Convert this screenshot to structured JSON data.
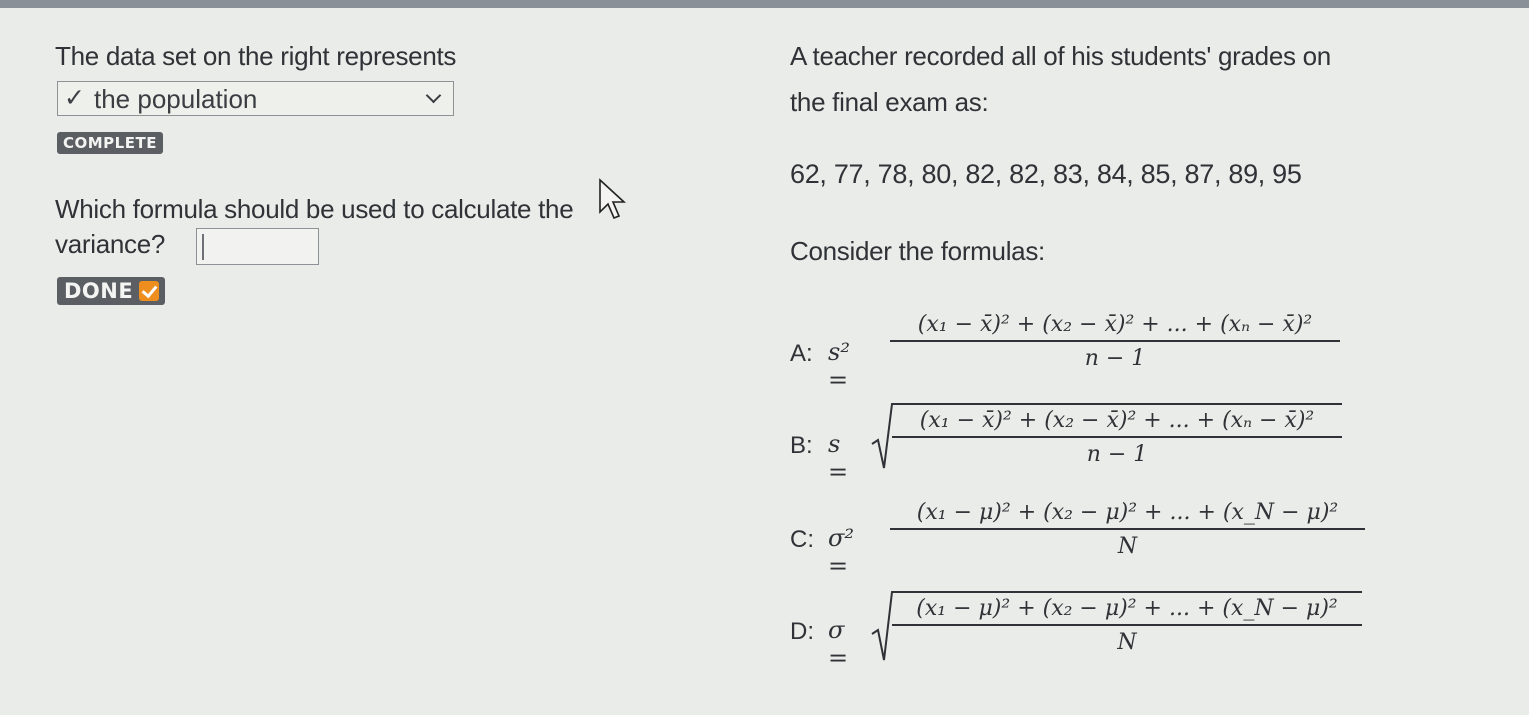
{
  "left": {
    "intro": "The data set on the right represents",
    "select": {
      "check": "✓",
      "value": "the population"
    },
    "complete_badge": "COMPLETE",
    "question_line1": "Which formula should be used to calculate the",
    "question_line2": "variance?",
    "answer_value": "",
    "done_badge": "DONE"
  },
  "right": {
    "line1": "A teacher recorded all of his students' grades on",
    "line2": "the final exam as:",
    "data_values": "62, 77, 78, 80, 82, 82, 83, 84, 85, 87, 89, 95",
    "consider": "Consider the formulas:"
  },
  "formulas": {
    "a": {
      "label": "A:",
      "lhs": "s² =",
      "numerator": "(x₁ − x̄)² + (x₂ − x̄)² + ... + (xₙ − x̄)²",
      "denominator": "n − 1"
    },
    "b": {
      "label": "B:",
      "lhs": "s =",
      "numerator": "(x₁ − x̄)² + (x₂ − x̄)² + ... + (xₙ − x̄)²",
      "denominator": "n − 1"
    },
    "c": {
      "label": "C:",
      "lhs": "σ² =",
      "numerator": "(x₁ − μ)² + (x₂ − μ)² + ... + (x_N − μ)²",
      "denominator": "N"
    },
    "d": {
      "label": "D:",
      "lhs": "σ =",
      "numerator": "(x₁ − μ)² + (x₂ − μ)² + ... + (x_N − μ)²",
      "denominator": "N"
    }
  },
  "icons": {
    "select_chevron": "chevron-down-icon",
    "done_check": "check-icon",
    "mouse_pointer": "mouse-pointer-icon"
  },
  "colors": {
    "badge_bg": "#5b5f64",
    "done_check": "#ee8e1e",
    "background": "#e9ece8"
  }
}
